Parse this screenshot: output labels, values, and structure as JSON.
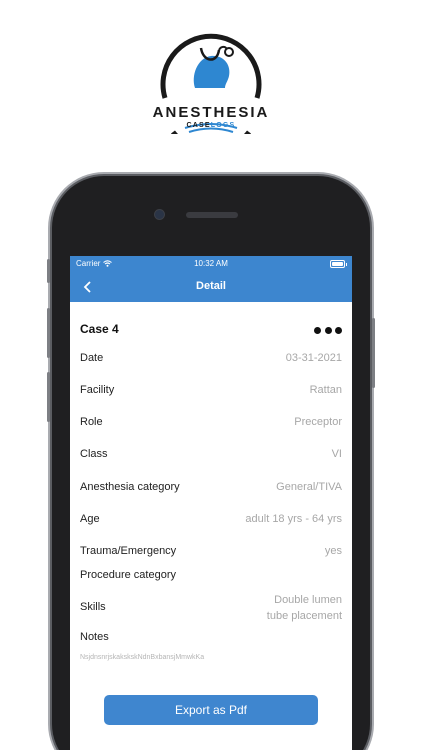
{
  "logo": {
    "title": "ANESTHESIA",
    "subtitle_part1": "CASE",
    "subtitle_part2": "LOGS",
    "accent_color": "#2e87d1"
  },
  "status_bar": {
    "carrier": "Carrier",
    "time": "10:32 AM",
    "battery_level": 1.0
  },
  "nav": {
    "title": "Detail",
    "back_icon": "chevron-left-icon"
  },
  "case": {
    "title": "Case 4",
    "more_icon": "more-horizontal-icon"
  },
  "details": [
    {
      "label": "Date",
      "value": "03-31-2021"
    },
    {
      "label": "Facility",
      "value": "Rattan"
    },
    {
      "label": "Role",
      "value": "Preceptor"
    },
    {
      "label": "Class",
      "value": "VI"
    },
    {
      "label": "Anesthesia category",
      "value": "General/TIVA"
    },
    {
      "label": "Age",
      "value": "adult 18 yrs - 64 yrs"
    },
    {
      "label": "Trauma/Emergency",
      "value": "yes"
    },
    {
      "label": "Procedure category",
      "value": ""
    },
    {
      "label": "Skills",
      "value_line1": "Double lumen",
      "value_line2": "tube placement"
    },
    {
      "label": "Notes",
      "value": ""
    }
  ],
  "notes_text": "NsjdnsnrjskakskskNdnBxbansjMmwkKa",
  "export_button": "Export as Pdf",
  "colors": {
    "primary": "#3d86cf",
    "value_text": "#a7a7a7"
  }
}
